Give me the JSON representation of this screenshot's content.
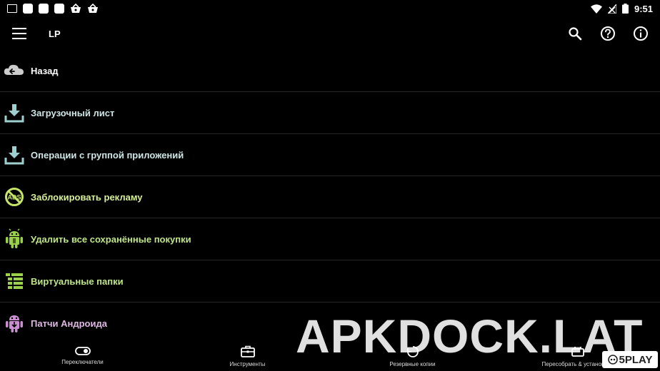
{
  "status_bar": {
    "time": "9:51",
    "left_icons": [
      "image-icon",
      "notification-square-icon",
      "notification-square-icon",
      "notification-square-icon",
      "basket-icon",
      "basket-icon"
    ],
    "right_icons": [
      "wifi-icon",
      "signal-icon",
      "battery-icon"
    ]
  },
  "app_bar": {
    "title": "LP",
    "actions": [
      "search-icon",
      "help-icon",
      "info-icon"
    ]
  },
  "menu": [
    {
      "label": "Назад",
      "icon": "back-cloud-icon",
      "color": "#ffffff",
      "icon_color": "#cccccc"
    },
    {
      "label": "Загрузочный лист",
      "icon": "download-icon",
      "color": "#cfe6e6",
      "icon_color": "#9fd0d0"
    },
    {
      "label": "Операции с группой приложений",
      "icon": "download-icon",
      "color": "#cfe6e6",
      "icon_color": "#9fd0d0"
    },
    {
      "label": "Заблокировать рекламу",
      "icon": "block-ads-icon",
      "color": "#d8ef9a",
      "icon_color": "#c6e56a"
    },
    {
      "label": "Удалить все сохранённые покупки",
      "icon": "android-icon",
      "color": "#bfe58a",
      "icon_color": "#9bd14a"
    },
    {
      "label": "Виртуальные папки",
      "icon": "folder-list-icon",
      "color": "#bfe58a",
      "icon_color": "#9bd14a"
    },
    {
      "label": "Патчи Андроида",
      "icon": "android-patch-icon",
      "color": "#e0b8e4",
      "icon_color": "#c98fd0"
    }
  ],
  "bottom_nav": [
    {
      "label": "Переключатели",
      "icon": "toggle-icon"
    },
    {
      "label": "Инструменты",
      "icon": "toolbox-icon"
    },
    {
      "label": "Резервные копии",
      "icon": "backup-icon"
    },
    {
      "label": "Пересобрать & установить",
      "icon": "rebuild-icon"
    }
  ],
  "watermark": {
    "text": "APKDOCK.LAT",
    "badge": "5PLAY"
  }
}
